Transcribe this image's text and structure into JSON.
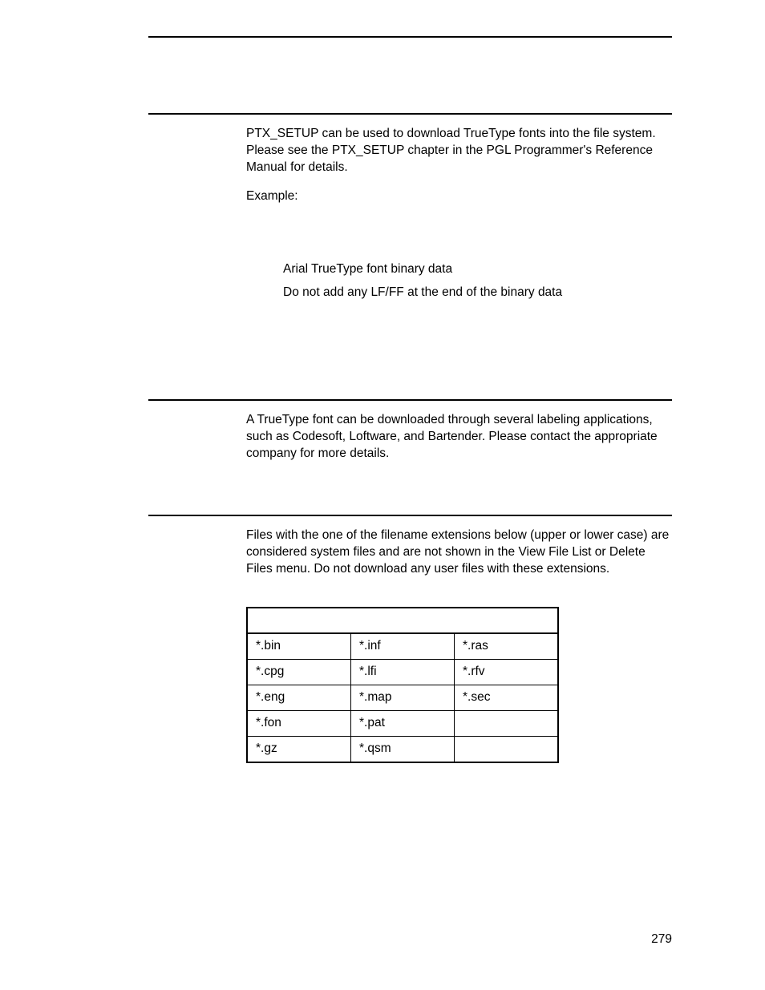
{
  "section1": {
    "para1": "PTX_SETUP can be used to download TrueType fonts into the file system. Please see the PTX_SETUP chapter in the PGL Programmer's Reference Manual for details.",
    "para2": "Example:",
    "example_line1": "Arial TrueType font binary data",
    "example_line2": "Do not add any LF/FF at the end of the binary data"
  },
  "section2": {
    "para1": "A TrueType font can be downloaded through several labeling applications, such as Codesoft, Loftware, and Bartender. Please contact the appropriate company for more details."
  },
  "section3": {
    "para1": "Files with the one of the filename extensions below (upper or lower case) are considered system files and are not shown in the View File List or Delete Files menu. Do not download any user files with these extensions."
  },
  "table": {
    "rows": [
      {
        "c1": "*.bin",
        "c2": "*.inf",
        "c3": "*.ras"
      },
      {
        "c1": "*.cpg",
        "c2": "*.lfi",
        "c3": "*.rfv"
      },
      {
        "c1": "*.eng",
        "c2": "*.map",
        "c3": "*.sec"
      },
      {
        "c1": "*.fon",
        "c2": "*.pat",
        "c3": ""
      },
      {
        "c1": "*.gz",
        "c2": "*.qsm",
        "c3": ""
      }
    ]
  },
  "page_number": "279"
}
